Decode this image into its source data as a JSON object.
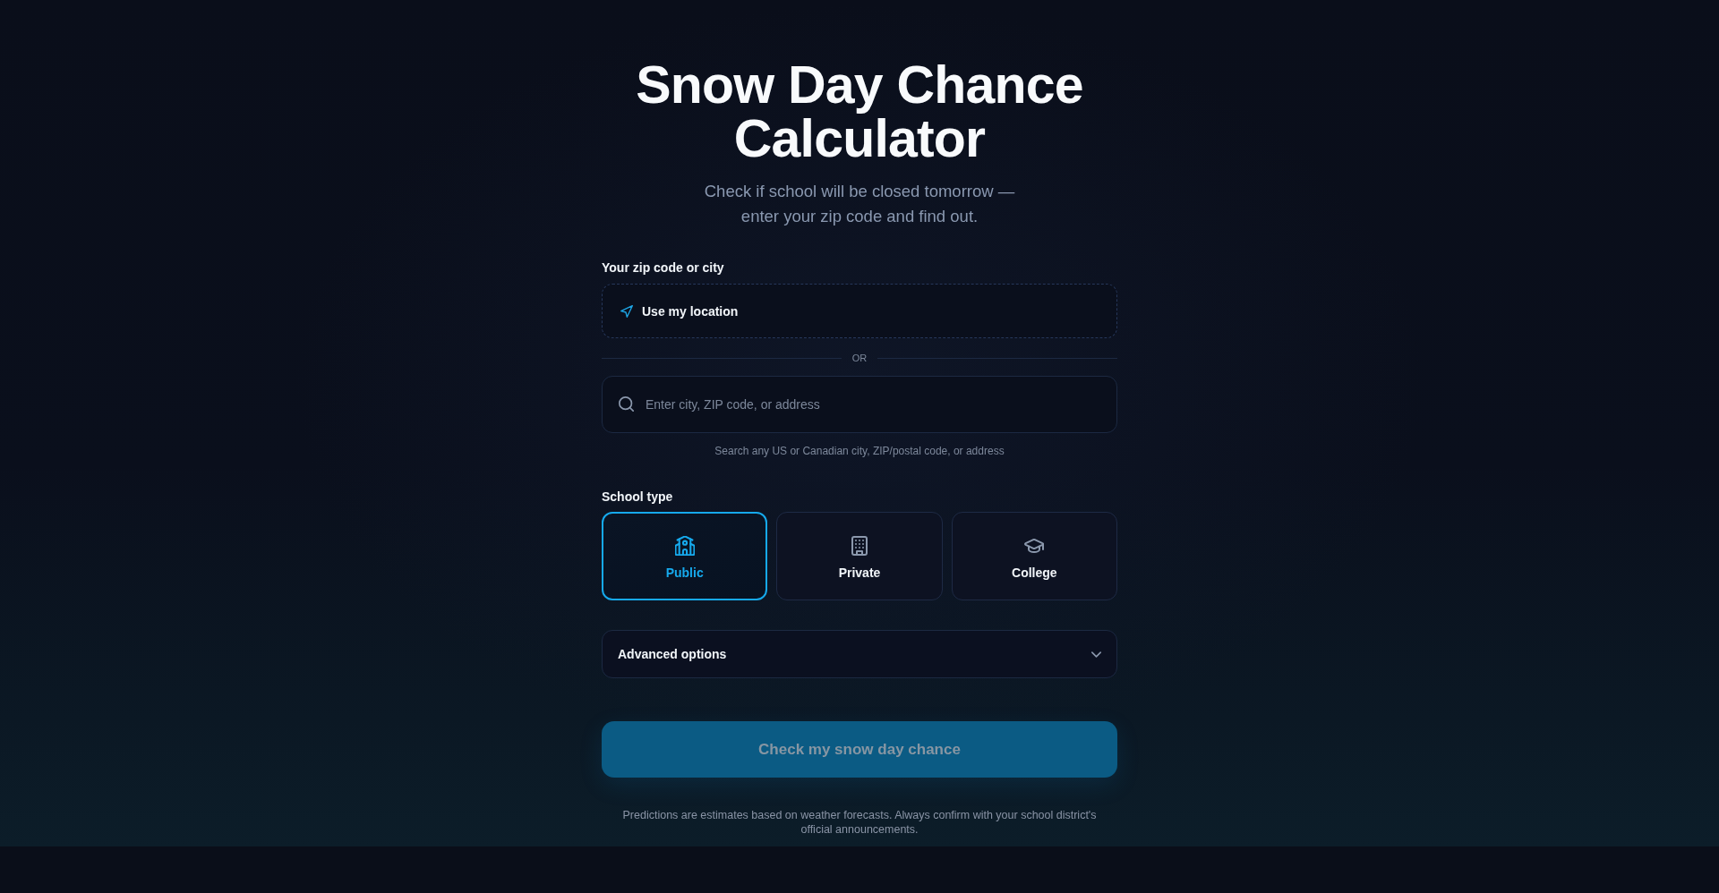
{
  "header": {
    "title": "Snow Day Chance Calculator",
    "subtitle": "Check if school will be closed tomorrow — enter your zip code and find out."
  },
  "location": {
    "label": "Your zip code or city",
    "use_location_button": "Use my location",
    "divider": "OR",
    "search": {
      "placeholder": "Enter city, ZIP code, or address"
    },
    "hint": "Search any US or Canadian city, ZIP/postal code, or address"
  },
  "school_type": {
    "label": "School type",
    "options": [
      {
        "label": "Public",
        "kind": "public",
        "selected": true
      },
      {
        "label": "Private",
        "kind": "private",
        "selected": false
      },
      {
        "label": "College",
        "kind": "college",
        "selected": false
      }
    ]
  },
  "advanced_options": {
    "label": "Advanced options",
    "expanded": false
  },
  "submit_button": {
    "label": "Check my snow day chance",
    "disabled": true
  },
  "disclaimer": "Predictions are estimates based on weather forecasts. Always confirm with your school district's official announcements."
}
